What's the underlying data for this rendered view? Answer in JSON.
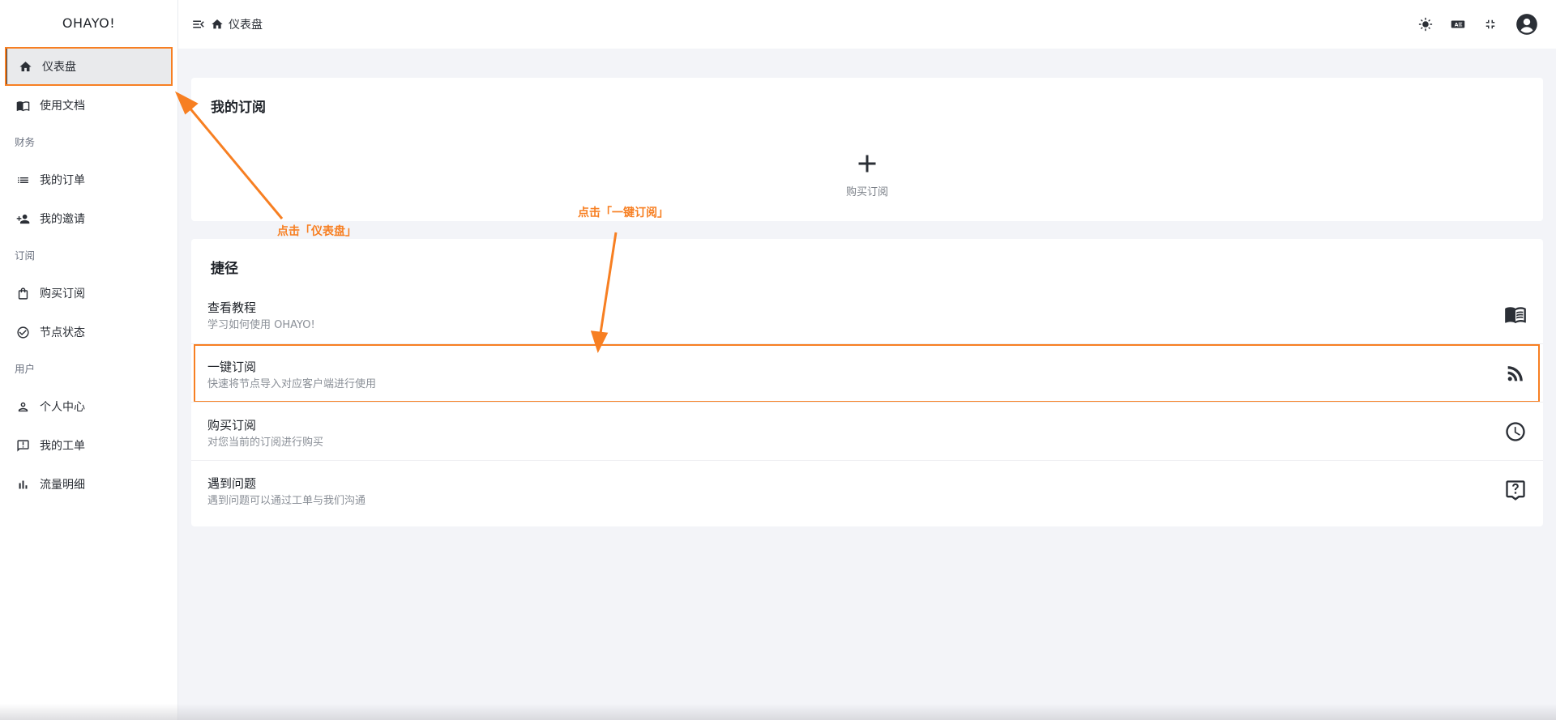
{
  "brand": "OHAYO!",
  "sidebar": {
    "items": [
      {
        "label": "仪表盘",
        "icon": "home-icon",
        "active": true
      },
      {
        "label": "使用文档",
        "icon": "book-icon"
      }
    ],
    "groups": [
      {
        "title": "财务",
        "items": [
          {
            "label": "我的订单",
            "icon": "list-icon"
          },
          {
            "label": "我的邀请",
            "icon": "invite-users-icon"
          }
        ]
      },
      {
        "title": "订阅",
        "items": [
          {
            "label": "购买订阅",
            "icon": "shopping-bag-icon"
          },
          {
            "label": "节点状态",
            "icon": "check-circle-icon"
          }
        ]
      },
      {
        "title": "用户",
        "items": [
          {
            "label": "个人中心",
            "icon": "person-icon"
          },
          {
            "label": "我的工单",
            "icon": "feedback-icon"
          },
          {
            "label": "流量明细",
            "icon": "bar-chart-icon"
          }
        ]
      }
    ]
  },
  "header": {
    "breadcrumb": "仪表盘",
    "icons": [
      "theme-sun-icon",
      "translate-icon",
      "fullscreen-exit-icon",
      "account-icon"
    ]
  },
  "subscription_card": {
    "title": "我的订阅",
    "buy_label": "购买订阅"
  },
  "shortcut_card": {
    "title": "捷径",
    "items": [
      {
        "title": "查看教程",
        "desc": "学习如何使用 OHAYO!",
        "icon": "book-open-icon"
      },
      {
        "title": "一键订阅",
        "desc": "快速将节点导入对应客户端进行使用",
        "icon": "rss-icon",
        "highlight": true
      },
      {
        "title": "购买订阅",
        "desc": "对您当前的订阅进行购买",
        "icon": "clock-icon"
      },
      {
        "title": "遇到问题",
        "desc": "遇到问题可以通过工单与我们沟通",
        "icon": "help-chat-icon"
      }
    ]
  },
  "annotations": {
    "dashboard_hint": "点击「仪表盘」",
    "subscribe_hint": "点击「一键订阅」",
    "color": "#f77f22"
  }
}
